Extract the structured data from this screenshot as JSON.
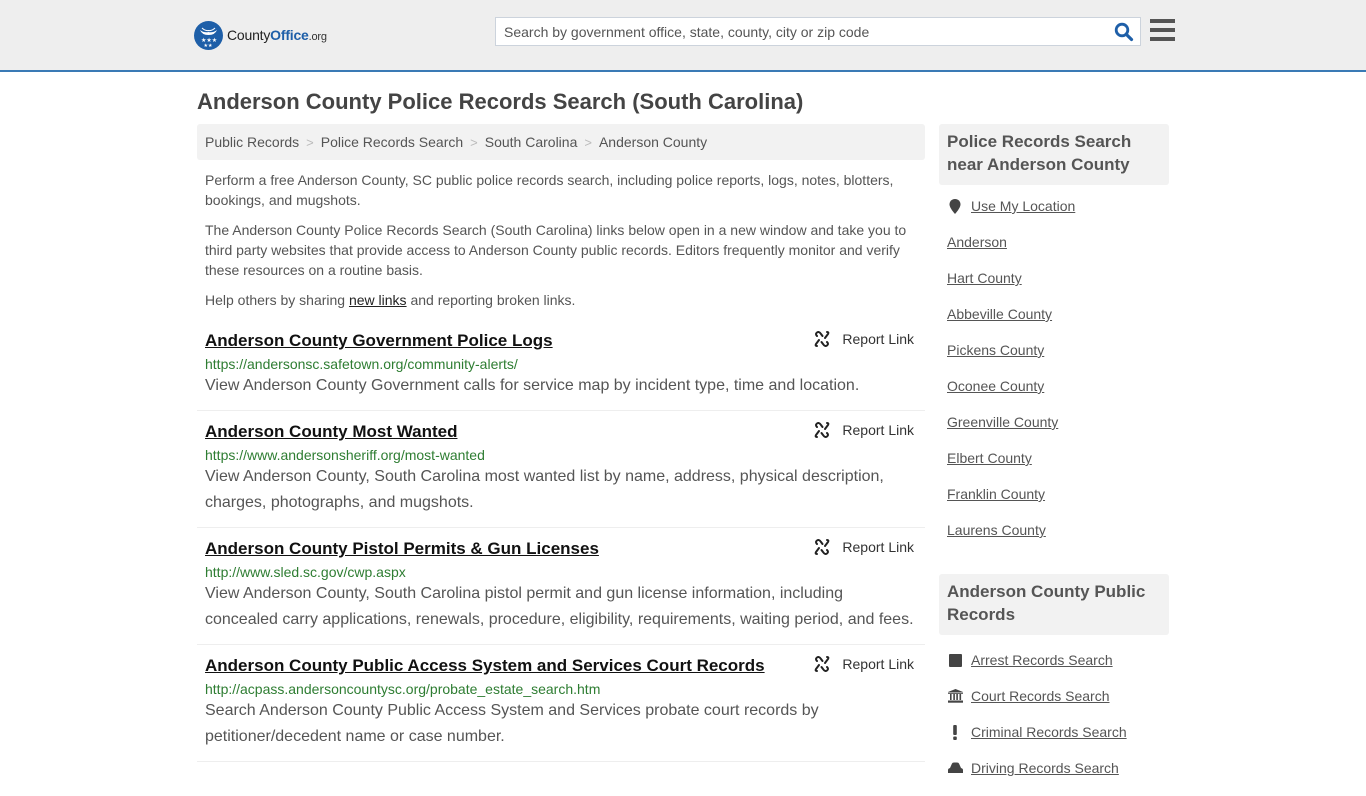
{
  "header": {
    "logo": {
      "county": "County",
      "office": "Office",
      "org": ".org"
    },
    "search_placeholder": "Search by government office, state, county, city or zip code",
    "search_icon": "search-icon",
    "menu_icon": "hamburger-menu-icon",
    "accent_color": "#3a7ab5"
  },
  "page": {
    "title": "Anderson County Police Records Search (South Carolina)"
  },
  "breadcrumb": [
    "Public Records",
    "Police Records Search",
    "South Carolina",
    "Anderson County"
  ],
  "intro": {
    "p1": "Perform a free Anderson County, SC public police records search, including police reports, logs, notes, blotters, bookings, and mugshots.",
    "p2": "The Anderson County Police Records Search (South Carolina) links below open in a new window and take you to third party websites that provide access to Anderson County public records. Editors frequently monitor and verify these resources on a routine basis.",
    "p3_before": "Help others by sharing ",
    "p3_link": "new links",
    "p3_after": " and reporting broken links."
  },
  "results": [
    {
      "title": "Anderson County Government Police Logs",
      "url": "https://andersonsc.safetown.org/community-alerts/",
      "desc": "View Anderson County Government calls for service map by incident type, time and location.",
      "report_label": "Report Link"
    },
    {
      "title": "Anderson County Most Wanted",
      "url": "https://www.andersonsheriff.org/most-wanted",
      "desc": "View Anderson County, South Carolina most wanted list by name, address, physical description, charges, photographs, and mugshots.",
      "report_label": "Report Link"
    },
    {
      "title": "Anderson County Pistol Permits & Gun Licenses",
      "url": "http://www.sled.sc.gov/cwp.aspx",
      "desc": "View Anderson County, South Carolina pistol permit and gun license information, including concealed carry applications, renewals, procedure, eligibility, requirements, waiting period, and fees.",
      "report_label": "Report Link"
    },
    {
      "title": "Anderson County Public Access System and Services Court Records",
      "url": "http://acpass.andersoncountysc.org/probate_estate_search.htm",
      "desc": "Search Anderson County Public Access System and Services probate court records by petitioner/decedent name or case number.",
      "report_label": "Report Link"
    }
  ],
  "sidebar": {
    "nearby": {
      "heading": "Police Records Search near Anderson County",
      "use_location": "Use My Location",
      "items": [
        "Anderson",
        "Hart County",
        "Abbeville County",
        "Pickens County",
        "Oconee County",
        "Greenville County",
        "Elbert County",
        "Franklin County",
        "Laurens County"
      ]
    },
    "public_records": {
      "heading": "Anderson County Public Records",
      "items": [
        {
          "label": "Arrest Records Search",
          "icon": "square-icon"
        },
        {
          "label": "Court Records Search",
          "icon": "courthouse-icon"
        },
        {
          "label": "Criminal Records Search",
          "icon": "exclamation-icon"
        },
        {
          "label": "Driving Records Search",
          "icon": "car-icon"
        }
      ]
    }
  }
}
